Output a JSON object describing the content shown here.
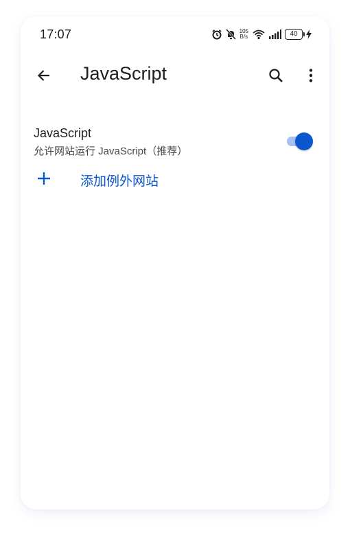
{
  "status_bar": {
    "time": "17:07",
    "net_speed_value": "105",
    "net_speed_unit": "B/s",
    "battery": "40",
    "icons": [
      "alarm-icon",
      "mute-icon",
      "wifi-icon",
      "signal-icon",
      "battery-icon",
      "charging-icon"
    ]
  },
  "app_bar": {
    "title": "JavaScript",
    "icons": [
      "back-arrow-icon",
      "search-icon",
      "more-vert-icon"
    ]
  },
  "setting": {
    "title": "JavaScript",
    "summary": "允许网站运行 JavaScript（推荐）",
    "toggle_on": true
  },
  "add_exception": {
    "label": "添加例外网站",
    "icon": "plus-icon"
  },
  "colors": {
    "accent": "#0b57d0",
    "toggle_track": "#a8c0f0",
    "text_primary": "#1f1f1f",
    "text_secondary": "#444746"
  }
}
